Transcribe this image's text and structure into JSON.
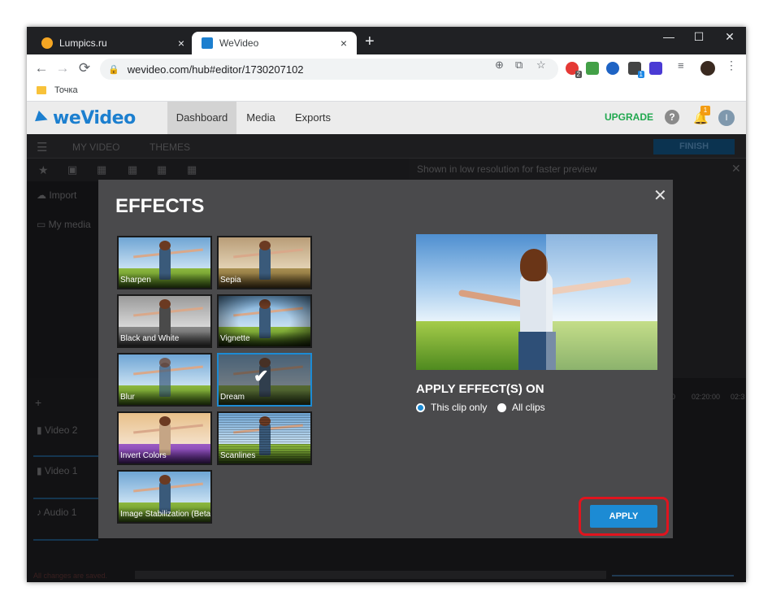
{
  "browser": {
    "tabs": [
      {
        "title": "Lumpics.ru",
        "close": "×"
      },
      {
        "title": "WeVideo",
        "close": "×"
      }
    ],
    "new_tab": "+",
    "window_controls": {
      "minimize": "—",
      "maximize": "☐",
      "close": "✕"
    },
    "nav": {
      "back": "←",
      "forward": "→",
      "reload": "⟳"
    },
    "address": "wevideo.com/hub#editor/1730207102",
    "bookmarks": [
      {
        "label": "Точка"
      }
    ],
    "extension_badges": {
      "ext1": "2",
      "ext2": "1"
    }
  },
  "app": {
    "logo": "weVideo",
    "nav": {
      "dashboard": "Dashboard",
      "media": "Media",
      "exports": "Exports"
    },
    "upgrade": "UPGRADE",
    "help": "?",
    "notifications_count": "1",
    "avatar_initial": "I"
  },
  "editor": {
    "top_bar": {
      "my_video": "MY VIDEO",
      "themes": "THEMES",
      "finish": "FINISH"
    },
    "media_panel": {
      "import": "Import",
      "my_media": "My media"
    },
    "preview_notice": "Shown in low resolution for faster preview",
    "timeline": {
      "tracks": [
        "Video 2",
        "Video 1",
        "Audio 1"
      ],
      "times": [
        "0",
        "02:20:00",
        "02:3"
      ]
    },
    "status": "All changes are saved."
  },
  "modal": {
    "title": "EFFECTS",
    "close": "✕",
    "effects": [
      {
        "label": "Sharpen",
        "selected": false
      },
      {
        "label": "Sepia",
        "selected": false
      },
      {
        "label": "Black and White",
        "selected": false
      },
      {
        "label": "Vignette",
        "selected": false
      },
      {
        "label": "Blur",
        "selected": false
      },
      {
        "label": "Dream",
        "selected": true
      },
      {
        "label": "Invert Colors",
        "selected": false
      },
      {
        "label": "Scanlines",
        "selected": false
      },
      {
        "label": "Image Stabilization (Beta)",
        "selected": false
      }
    ],
    "selected_check": "✔",
    "apply_on_title": "APPLY EFFECT(S) ON",
    "options": [
      {
        "label": "This clip only",
        "checked": true
      },
      {
        "label": "All clips",
        "checked": false
      }
    ],
    "apply_label": "APPLY"
  },
  "colors": {
    "accent": "#1c8bd4",
    "upgrade": "#21a84f",
    "highlight": "#e0141e",
    "notification": "#f39c12"
  }
}
